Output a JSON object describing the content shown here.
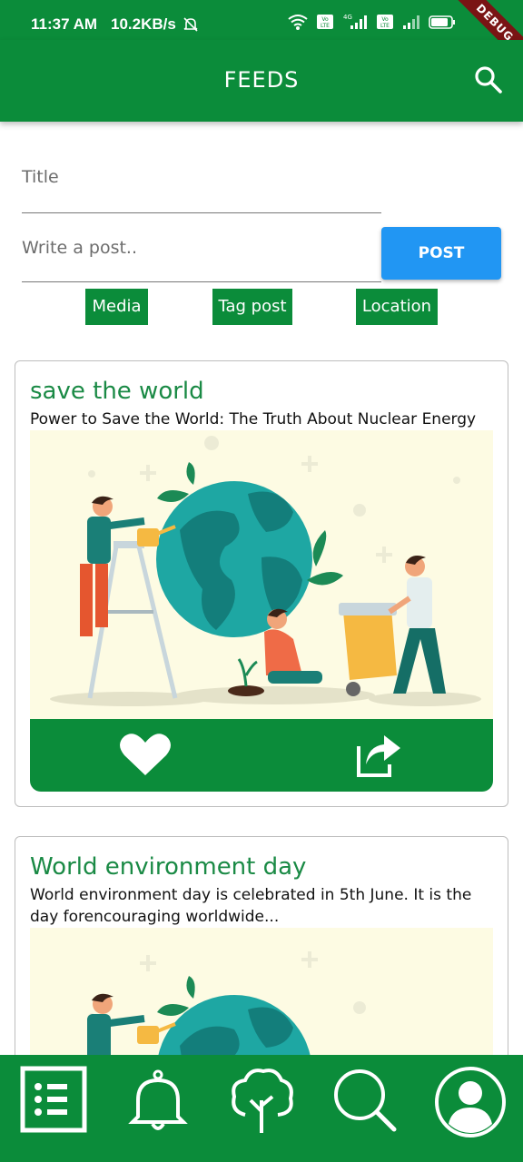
{
  "status_bar": {
    "time": "11:37 AM",
    "speed": "10.2KB/s",
    "debug_label": "DEBUG"
  },
  "app_bar": {
    "title": "FEEDS",
    "icon": "search-icon"
  },
  "compose": {
    "title_placeholder": "Title",
    "post_placeholder": "Write a post..",
    "post_button": "POST",
    "chips": [
      "Media",
      "Tag post",
      "Location"
    ]
  },
  "feed": [
    {
      "title": "save the world",
      "description": "Power to Save the World: The Truth About Nuclear Energy",
      "actions": [
        "heart-icon",
        "share-icon"
      ]
    },
    {
      "title": "World environment day",
      "description": "World environment day is celebrated in 5th June. It is the day forencouraging worldwide..."
    }
  ],
  "bottom_nav": [
    "feed-list-icon",
    "bell-icon",
    "tree-icon",
    "search-icon",
    "profile-icon"
  ],
  "colors": {
    "primary": "#0b8c3a",
    "accent": "#2196f3",
    "card_title": "#1a8a45",
    "image_bg": "#fdfbe3"
  }
}
